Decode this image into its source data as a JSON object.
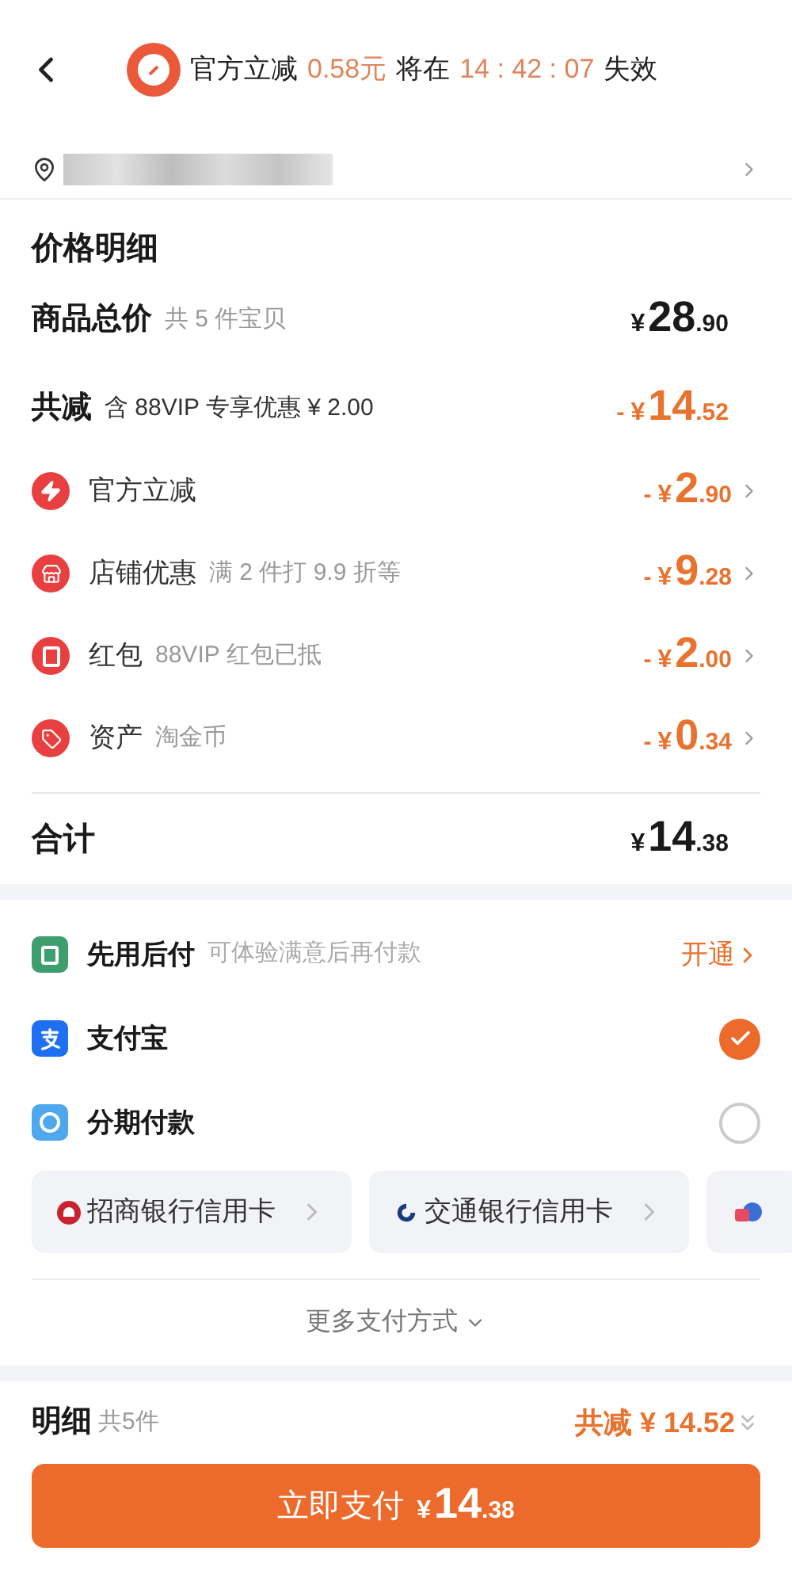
{
  "header": {
    "notice": [
      {
        "text": "官方立减",
        "highlight": false
      },
      {
        "text": "0.58元",
        "highlight": true
      },
      {
        "text": "将在",
        "highlight": false
      },
      {
        "text": "14 : 42 : 07",
        "highlight": true
      },
      {
        "text": "失效",
        "highlight": false
      }
    ]
  },
  "price_detail": {
    "title": "价格明细",
    "summary": [
      {
        "label": "商品总价",
        "note": "共 5 件宝贝",
        "currency": "¥",
        "whole": "28",
        "fraction": ".90",
        "discount": false
      },
      {
        "label": "共减",
        "note": "含 88VIP 专享优惠 ¥ 2.00",
        "sign": "-",
        "currency": "¥",
        "whole": "14",
        "fraction": ".52",
        "discount": true
      }
    ],
    "items": [
      {
        "kind": "bolt",
        "label": "官方立减",
        "sign": "-",
        "currency": "¥",
        "whole": "2",
        "fraction": ".90"
      },
      {
        "kind": "store",
        "label": "店铺优惠",
        "note": "满 2 件打 9.9 折等",
        "sign": "-",
        "currency": "¥",
        "whole": "9",
        "fraction": ".28"
      },
      {
        "kind": "envelope",
        "label": "红包",
        "note": "88VIP 红包已抵",
        "sign": "-",
        "currency": "¥",
        "whole": "2",
        "fraction": ".00"
      },
      {
        "kind": "tag",
        "label": "资产",
        "note": "淘金币",
        "sign": "-",
        "currency": "¥",
        "whole": "0",
        "fraction": ".34"
      }
    ],
    "total": {
      "label": "合计",
      "currency": "¥",
      "whole": "14",
      "fraction": ".38"
    }
  },
  "payment": {
    "methods": [
      {
        "kind": "later",
        "label": "先用后付",
        "note": "可体验满意后再付款",
        "action": "开通"
      },
      {
        "kind": "alipay",
        "label": "支付宝",
        "selected": true
      },
      {
        "kind": "installment",
        "label": "分期付款",
        "selected": false
      }
    ],
    "cards": [
      {
        "kind": "cmb",
        "label": "招商银行信用卡"
      },
      {
        "kind": "bocom",
        "label": "交通银行信用卡"
      },
      {
        "kind": "other"
      }
    ],
    "more": "更多支付方式"
  },
  "footer": {
    "label": "明细",
    "count": "共5件",
    "discount": "共减 ¥ 14.52",
    "button": {
      "label": "立即支付",
      "currency": "¥",
      "whole": "14",
      "fraction": ".38"
    }
  }
}
